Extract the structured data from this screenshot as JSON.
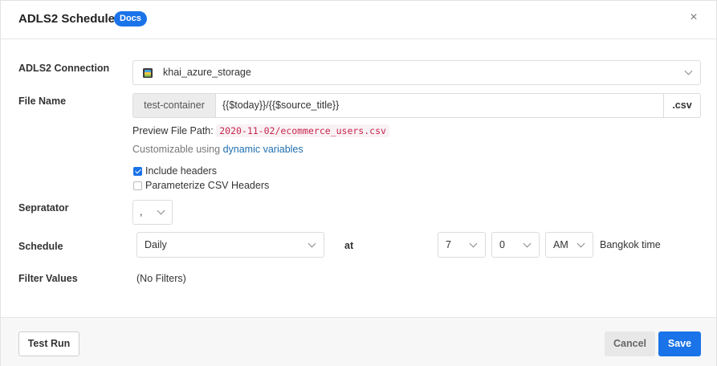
{
  "header": {
    "title": "ADLS2 Schedules",
    "docs_badge": "Docs",
    "close_symbol": "×"
  },
  "connection": {
    "label": "ADLS2 Connection",
    "value": "khai_azure_storage",
    "icon": "azure-storage-icon"
  },
  "file_name": {
    "label": "File Name",
    "container": "test-container",
    "path": "{{$today}}/{{$source_title}}",
    "extension": ".csv",
    "preview_label": "Preview File Path:",
    "preview_value": "2020-11-02/ecommerce_users.csv",
    "customizable_text": "Customizable using",
    "dynamic_link": "dynamic variables"
  },
  "options": {
    "include_headers": {
      "label": "Include headers",
      "checked": true
    },
    "parameterize": {
      "label": "Parameterize CSV Headers",
      "checked": false
    }
  },
  "separator": {
    "label": "Sepratator",
    "value": ","
  },
  "schedule": {
    "label": "Schedule",
    "frequency": "Daily",
    "at_label": "at",
    "hour": "7",
    "minute": "0",
    "ampm": "AM",
    "timezone": "Bangkok time"
  },
  "filters": {
    "label": "Filter Values",
    "value": "(No Filters)"
  },
  "footer": {
    "test_run": "Test Run",
    "cancel": "Cancel",
    "save": "Save"
  },
  "colors": {
    "primary": "#1a73e8",
    "code_text": "#c7254e",
    "link": "#1f6fb2"
  }
}
